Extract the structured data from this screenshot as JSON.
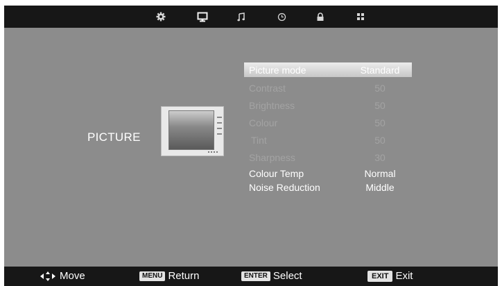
{
  "top_tabs": [
    {
      "icon": "gear-icon"
    },
    {
      "icon": "monitor-icon"
    },
    {
      "icon": "music-note-icon"
    },
    {
      "icon": "clock-icon"
    },
    {
      "icon": "lock-icon"
    },
    {
      "icon": "grid-icon"
    }
  ],
  "section": {
    "title": "PICTURE"
  },
  "menu": {
    "picture_mode": {
      "label": "Picture  mode",
      "value": "Standard"
    },
    "contrast": {
      "label": "Contrast",
      "value": "50"
    },
    "brightness": {
      "label": "Brightness",
      "value": "50"
    },
    "colour": {
      "label": "Colour",
      "value": "50"
    },
    "tint": {
      "label": "Tint",
      "value": "50"
    },
    "sharpness": {
      "label": "Sharpness",
      "value": "30"
    },
    "colour_temp": {
      "label": "Colour Temp",
      "value": "Normal"
    },
    "noise_reduction": {
      "label": "Noise Reduction",
      "value": "Middle"
    }
  },
  "bottom": {
    "move": "Move",
    "menu_key": "MENU",
    "return": "Return",
    "enter_key": "ENTER",
    "select": "Select",
    "exit_key": "EXIT",
    "exit": "Exit"
  },
  "colors": {
    "background": "#8c8c8c",
    "bars": "#171717",
    "highlight": "#d8d8d8",
    "disabled_text": "#a3a3a3"
  }
}
